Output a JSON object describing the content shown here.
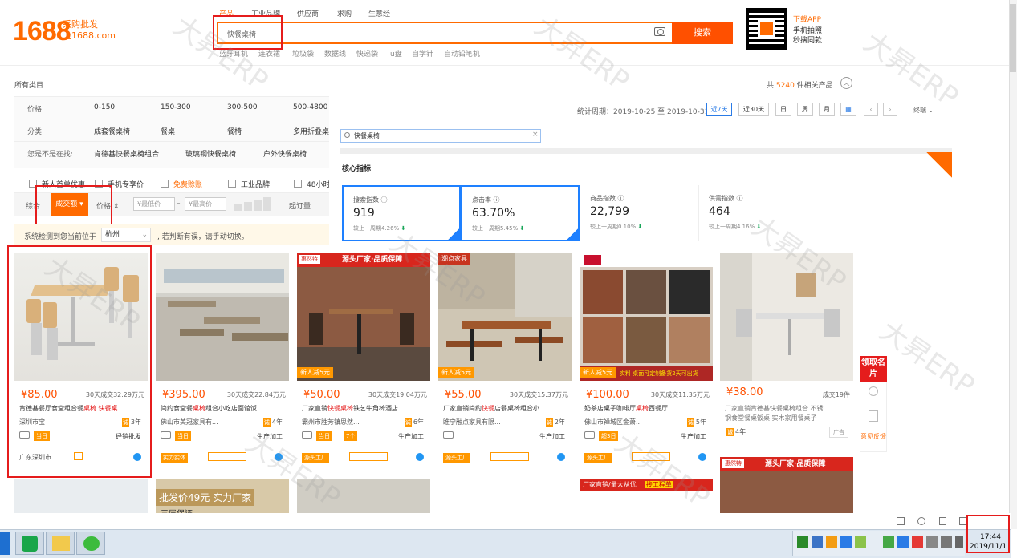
{
  "header": {
    "logo": "1688",
    "logo_sub_l1": "采购批发",
    "logo_sub_l2": "上1688.com",
    "tabs": [
      "产品",
      "工业品牌",
      "供应商",
      "求购",
      "生意经"
    ],
    "search_value": "快餐桌椅",
    "search_button": "搜索",
    "hot_keywords": [
      "蓝牙耳机",
      "连衣裙",
      "垃圾袋",
      "数据线",
      "快递袋",
      "u盘",
      "自学针",
      "自动铅笔机"
    ],
    "app_title": "下载APP",
    "app_l1": "手机拍照",
    "app_l2": "秒搜同款"
  },
  "results": {
    "all_categories": "所有类目",
    "total_prefix": "共",
    "total_count": "5240",
    "total_suffix": "件相关产品"
  },
  "filters": {
    "price_label": "价格:",
    "prices": [
      "0-150",
      "150-300",
      "300-500",
      "500-4800"
    ],
    "category_label": "分类:",
    "categories": [
      "成套餐桌椅",
      "餐桌",
      "餐椅",
      "多用折叠桌"
    ],
    "suggest_label": "您是不是在找:",
    "suggestions": [
      "肯德基快餐桌椅组合",
      "玻璃钢快餐桌椅",
      "户外快餐桌椅"
    ],
    "checks": [
      "新人首单优惠",
      "手机专享价",
      "免费赊账",
      "工业品牌",
      "48小时"
    ]
  },
  "sort": {
    "comprehensive": "综合",
    "deal": "成交额",
    "price": "价格",
    "min_price": "¥最低价",
    "max_price": "¥最高价",
    "moq": "起订量",
    "location_text": "系统检测到您当前位于",
    "location_value": "杭州",
    "location_after": ", 若判断有误，请手动切换。"
  },
  "stats": {
    "period_label": "统计周期：2019-10-25 至 2019-10-31",
    "period_buttons": [
      "近7天",
      "近30天",
      "日",
      "周",
      "月"
    ],
    "status": "终端",
    "keyword": "快餐桌椅",
    "core_title": "核心指标",
    "cards": [
      {
        "name": "搜索指数 ⓘ",
        "value": "919",
        "compare": "较上一周期4.26%"
      },
      {
        "name": "点击率 ⓘ",
        "value": "63.70%",
        "compare": "较上一周期5.45%"
      },
      {
        "name": "商品指数 ⓘ",
        "value": "22,799",
        "compare": "较上一周期0.10%"
      },
      {
        "name": "供需指数 ⓘ",
        "value": "464",
        "compare": "较上一周期4.16%"
      }
    ]
  },
  "products": [
    {
      "price": "¥85.00",
      "sales": "30天成交32.29万元",
      "title_pre": "肯德基餐厅食堂组合餐",
      "title_hl": "桌椅 快餐桌",
      "shop": "深圳市宝",
      "years": "3年",
      "mode": "经销批发",
      "region": "广东深圳市",
      "today": "当日"
    },
    {
      "price": "¥395.00",
      "sales": "30天成交22.84万元",
      "title_pre": "简约食堂餐",
      "title_hl": "桌椅",
      "title_post": "组合小吃店面馆饭",
      "shop": "佛山市美冠家具有...",
      "years": "4年",
      "mode": "生产加工",
      "badge": "实力实体",
      "today": "当日"
    },
    {
      "price": "¥50.00",
      "sales": "30天成交19.04万元",
      "title_pre": "厂家直销",
      "title_hl": "快餐桌椅",
      "title_post": "铁艺牛角椅酒店...",
      "shop": "霸州市胜芳镇思然...",
      "years": "6年",
      "mode": "生产加工",
      "badge": "源头工厂",
      "promo": "新人减5元",
      "top": "源头厂家·品质保障",
      "today": "当日",
      "extra": "7个"
    },
    {
      "price": "¥55.00",
      "sales": "30天成交15.37万元",
      "title_pre": "厂家直销简约",
      "title_hl": "快餐",
      "title_post": "店餐桌椅组合小...",
      "shop": "睢宁融点家具有限...",
      "years": "2年",
      "mode": "生产加工",
      "badge": "源头工厂",
      "promo": "新人减5元",
      "today": "潮点家具"
    },
    {
      "price": "¥100.00",
      "sales": "30天成交11.35万元",
      "title_pre": "奶茶店桌子咖啡厅",
      "title_hl": "桌椅",
      "title_post": "西餐厅",
      "shop": "佛山市禅城区金萧...",
      "years": "5年",
      "mode": "生产加工",
      "badge": "源头工厂",
      "promo": "新人减5元",
      "bottom": "实料 桌面可定制备货2天可出货",
      "today": "超3日"
    },
    {
      "price": "¥38.00",
      "sales": "成交19件",
      "title_pre": "厂家直销肯德基快餐桌椅组合 不锈",
      "title_l2": "钢食堂餐桌饭桌 实木家用餐桌子",
      "years": "4年",
      "ad": "广告"
    }
  ],
  "row2": {
    "p2_text": "批发价49元 实力厂家",
    "p2_sub": "三层保证",
    "p5_top": "厂家直销/量大从优",
    "p5_btn": "接工程单",
    "p6_top": "源头厂家·品质保障"
  },
  "float": {
    "red": "领取名片",
    "feedback": "意见反馈"
  },
  "taskbar": {
    "time": "17:44",
    "date": "2019/11/1"
  },
  "watermark": "大昇ERP",
  "colors": {
    "accent": "#ff6a00",
    "search_btn": "#ff5000",
    "highlight": "#e51c1c",
    "select": "#1e80ff"
  }
}
